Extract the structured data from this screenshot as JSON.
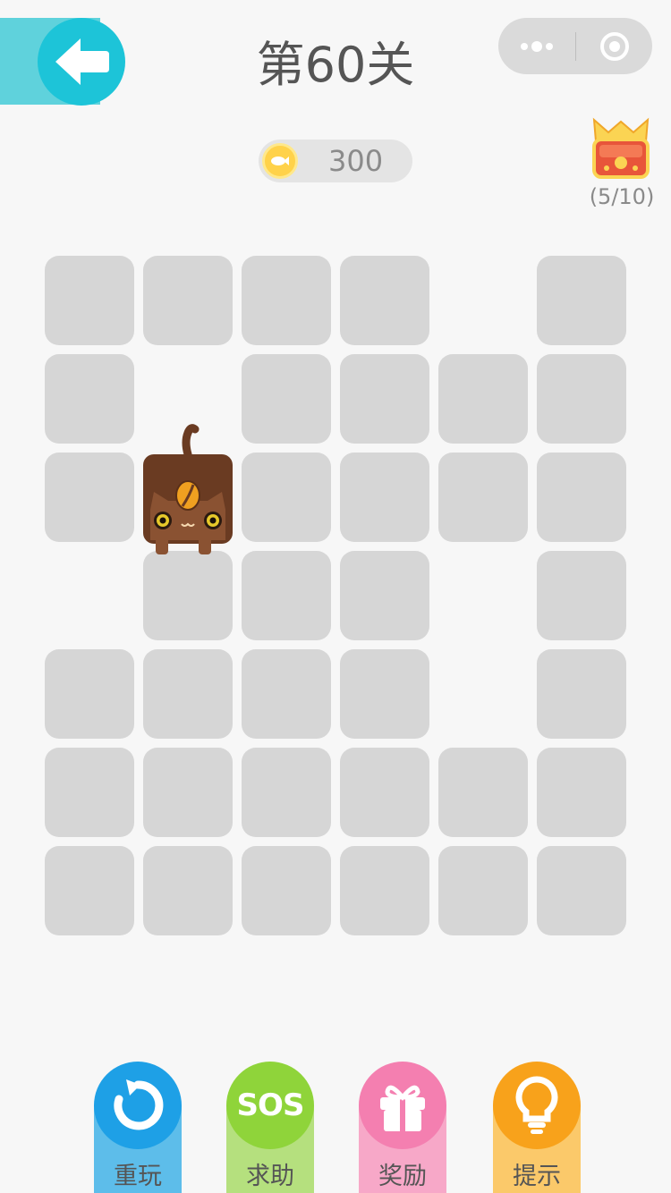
{
  "header": {
    "title": "第60关"
  },
  "coins": {
    "value": "300"
  },
  "chest": {
    "progress": "(5/10)"
  },
  "board": {
    "rows": 7,
    "cols": 6,
    "layout": [
      [
        1,
        1,
        1,
        1,
        0,
        1
      ],
      [
        1,
        0,
        1,
        1,
        1,
        1
      ],
      [
        1,
        0,
        1,
        1,
        1,
        1
      ],
      [
        0,
        1,
        1,
        1,
        0,
        1
      ],
      [
        1,
        1,
        1,
        1,
        0,
        1
      ],
      [
        1,
        1,
        1,
        1,
        1,
        1
      ],
      [
        1,
        1,
        1,
        1,
        1,
        1
      ]
    ],
    "cat_position": {
      "row": 2,
      "col": 1
    }
  },
  "actions": [
    {
      "label": "重玩",
      "icon": "replay-icon",
      "color": "#1ea0e6",
      "tab_color": "#5dbdea"
    },
    {
      "label": "求助",
      "icon": "sos-icon",
      "icon_text": "SOS",
      "color": "#8fd43a",
      "tab_color": "#b5e07e"
    },
    {
      "label": "奖励",
      "icon": "gift-icon",
      "color": "#f47fb0",
      "tab_color": "#f7a8c8"
    },
    {
      "label": "提示",
      "icon": "lightbulb-icon",
      "color": "#f8a21b",
      "tab_color": "#fbc96a"
    }
  ],
  "colors": {
    "tile": "#d6d6d6",
    "cat": "#6a3b22",
    "accent": "#1dc4d8"
  }
}
